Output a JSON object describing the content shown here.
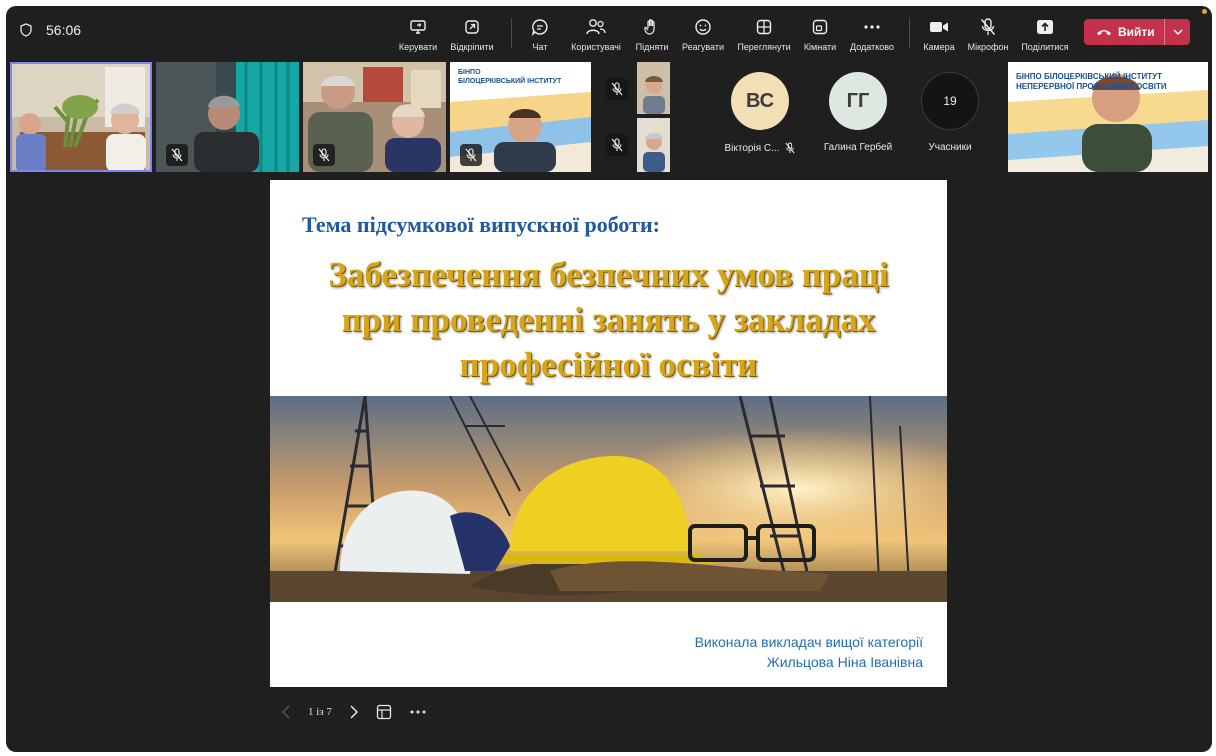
{
  "toolbar": {
    "timer": "56:06",
    "buttons": [
      {
        "id": "manage",
        "label": "Керувати",
        "icon": "share-screen-icon"
      },
      {
        "id": "popout",
        "label": "Відкріпити",
        "icon": "popout-icon"
      },
      {
        "id": "chat",
        "label": "Чат",
        "icon": "chat-icon"
      },
      {
        "id": "people",
        "label": "Користувачі",
        "icon": "people-icon"
      },
      {
        "id": "raise",
        "label": "Підняти",
        "icon": "raise-hand-icon"
      },
      {
        "id": "react",
        "label": "Реагувати",
        "icon": "smiley-icon"
      },
      {
        "id": "view",
        "label": "Переглянути",
        "icon": "grid-view-icon"
      },
      {
        "id": "rooms",
        "label": "Кімнати",
        "icon": "rooms-icon"
      },
      {
        "id": "more",
        "label": "Додатково",
        "icon": "more-dots-icon"
      },
      {
        "id": "camera",
        "label": "Камера",
        "icon": "camera-icon"
      },
      {
        "id": "mic",
        "label": "Мікрофон",
        "icon": "mic-off-icon"
      },
      {
        "id": "share",
        "label": "Поділитися",
        "icon": "share-up-icon"
      }
    ],
    "leave_label": "Вийти",
    "leave_color": "#c4314b",
    "accent": "#7f85f5"
  },
  "participants": {
    "vs": {
      "initials": "ВС",
      "name": "Вікторія С...",
      "color": "#f2dfb5"
    },
    "gg": {
      "initials": "ГГ",
      "name": "Галина Гербей",
      "color": "#dfe8e0"
    },
    "count": {
      "value": "19",
      "label": "Учасники"
    },
    "banner": {
      "org_short": "БІНПО",
      "line1": "БІЛОЦЕРКІВСЬКИЙ ІНСТИТУТ",
      "line2": "НЕПЕРЕРВНОЇ ПРОФЕСІЙНОЇ ОСВІТИ"
    }
  },
  "slide": {
    "topic": "Тема підсумкової випускної роботи:",
    "title_lines": [
      "Забезпечення безпечних умов праці",
      "при проведенні занять у закладах",
      "професійної освіти"
    ],
    "author_line1": "Виконала викладач вищої категорії",
    "author_line2": "Жильцова Ніна Іванівна"
  },
  "slide_controls": {
    "page": "1 із 7"
  }
}
